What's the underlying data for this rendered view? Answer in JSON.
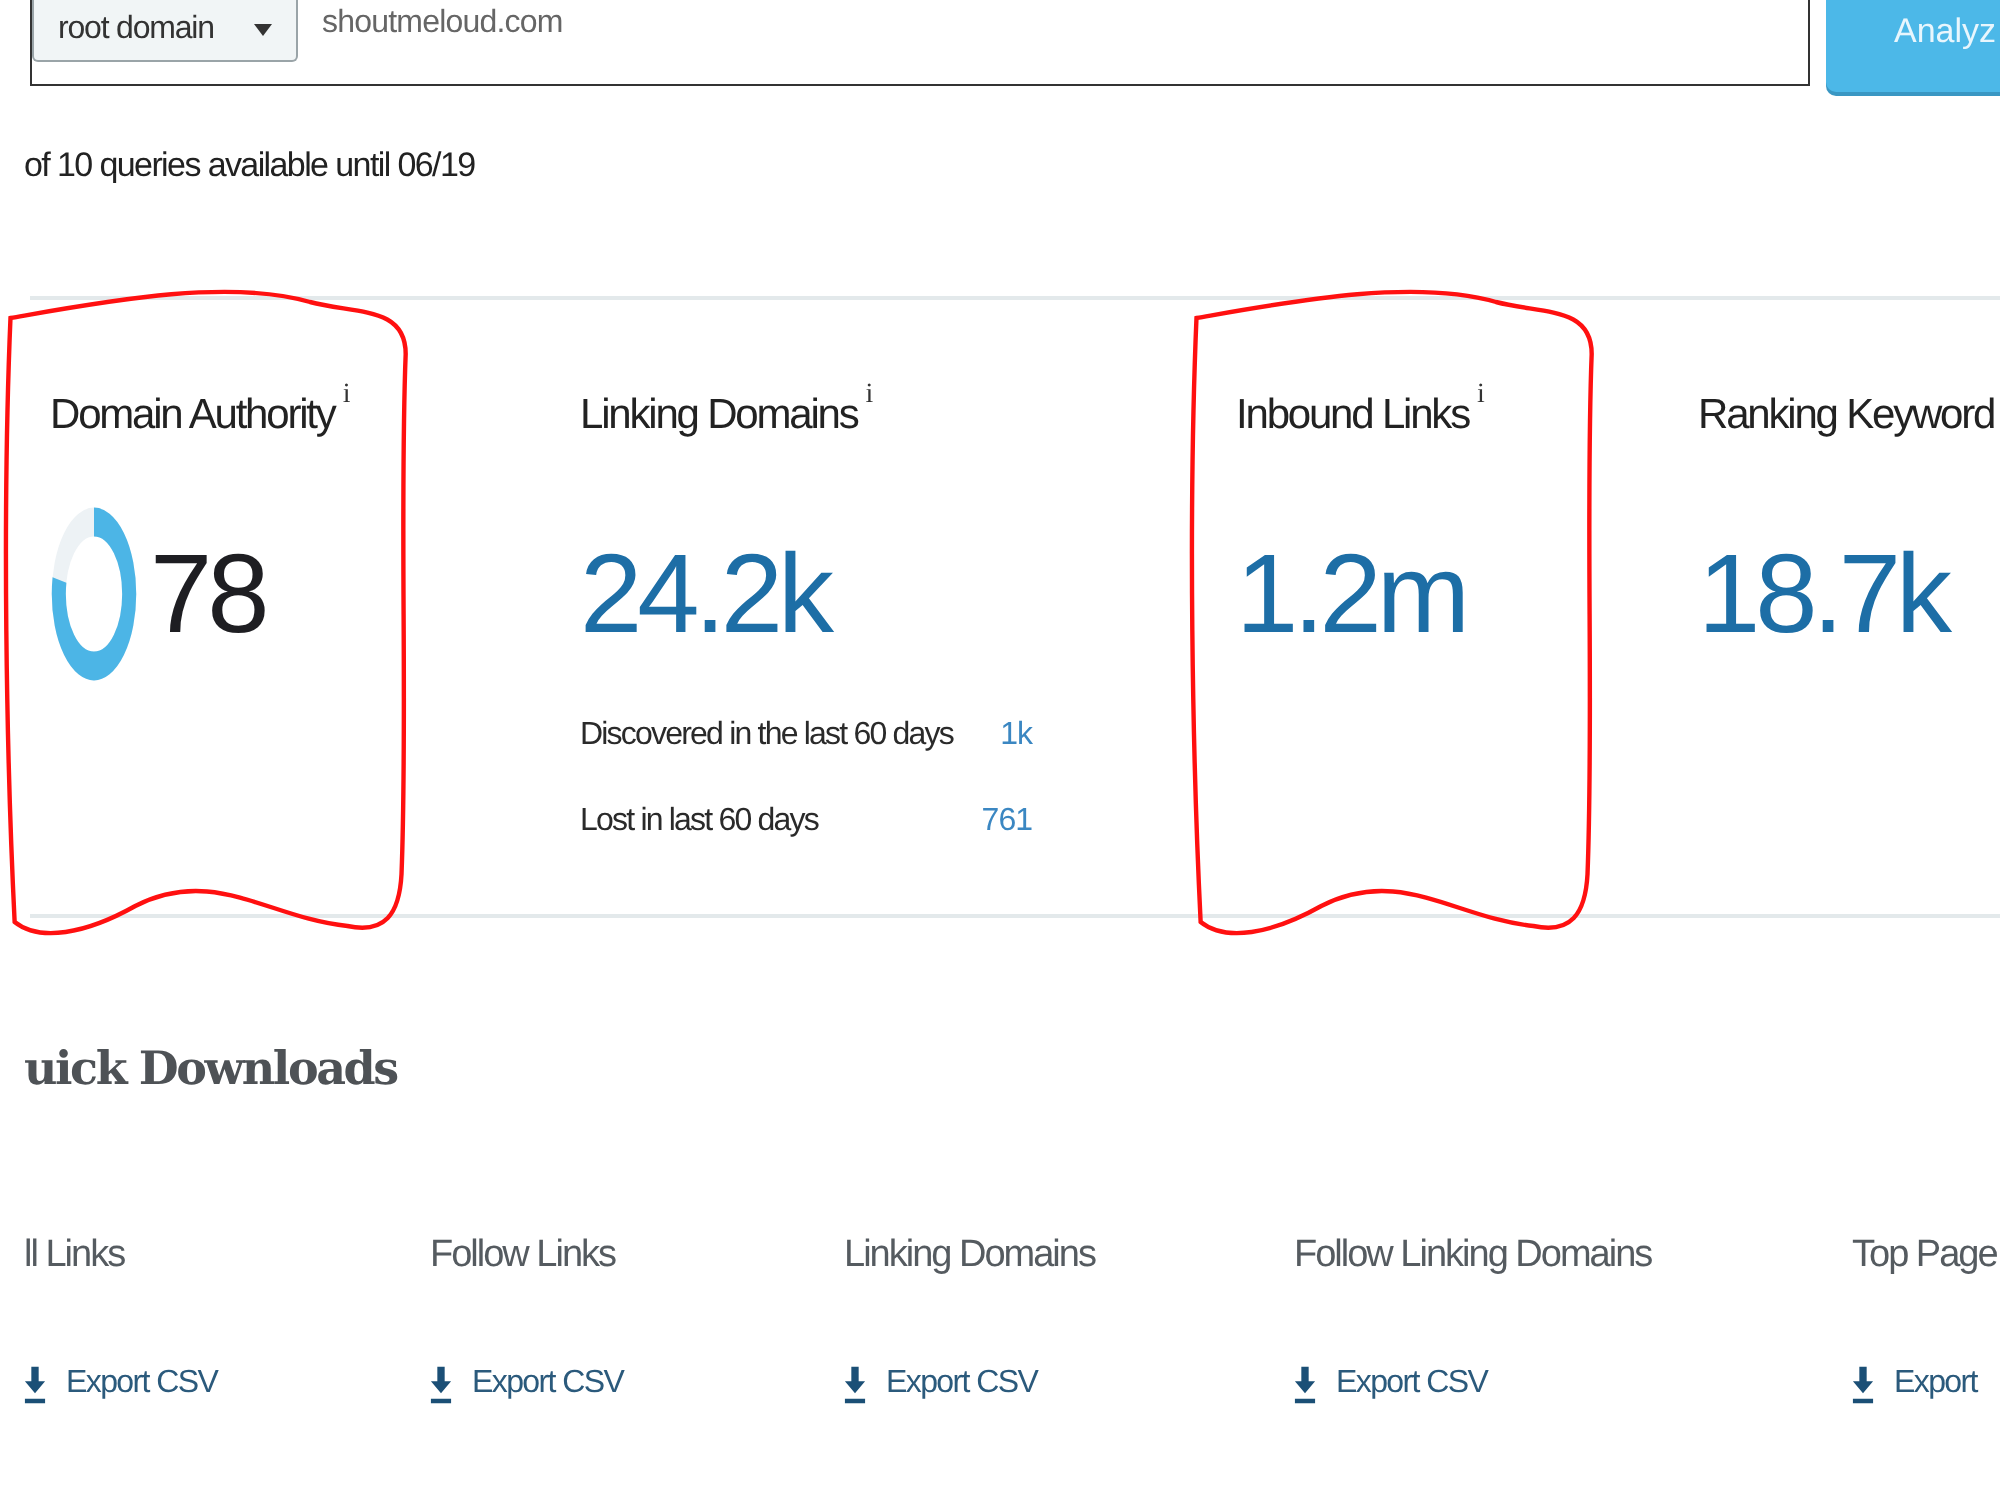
{
  "search_bar": {
    "scope_dropdown": "root domain",
    "query": "shoutmeloud.com",
    "analyze_button": "Analyz"
  },
  "quota_note": "of 10 queries available until 06/19",
  "metrics": [
    {
      "kind": "gauge",
      "title": "Domain Authority",
      "info": "i",
      "value": "78",
      "level": 0.78,
      "highlighted": true
    },
    {
      "kind": "number",
      "title": "Linking Domains",
      "info": "i",
      "value": "24.2k",
      "highlighted": false,
      "details": [
        {
          "label": "Discovered in the last 60 days",
          "value": "1k"
        },
        {
          "label": "Lost in last 60 days",
          "value": "761"
        }
      ]
    },
    {
      "kind": "number",
      "title": "Inbound Links",
      "info": "i",
      "value": "1.2m",
      "highlighted": true
    },
    {
      "kind": "number",
      "title": "Ranking Keyword",
      "value": "18.7k",
      "highlighted": false
    }
  ],
  "quick_downloads": {
    "title": "uick Downloads",
    "items": [
      {
        "title": "ll Links",
        "action": "Export CSV"
      },
      {
        "title": "Follow Links",
        "action": "Export CSV"
      },
      {
        "title": "Linking Domains",
        "action": "Export CSV"
      },
      {
        "title": "Follow Linking Domains",
        "action": "Export CSV"
      },
      {
        "title": "Top Page",
        "action": "Export"
      }
    ]
  }
}
